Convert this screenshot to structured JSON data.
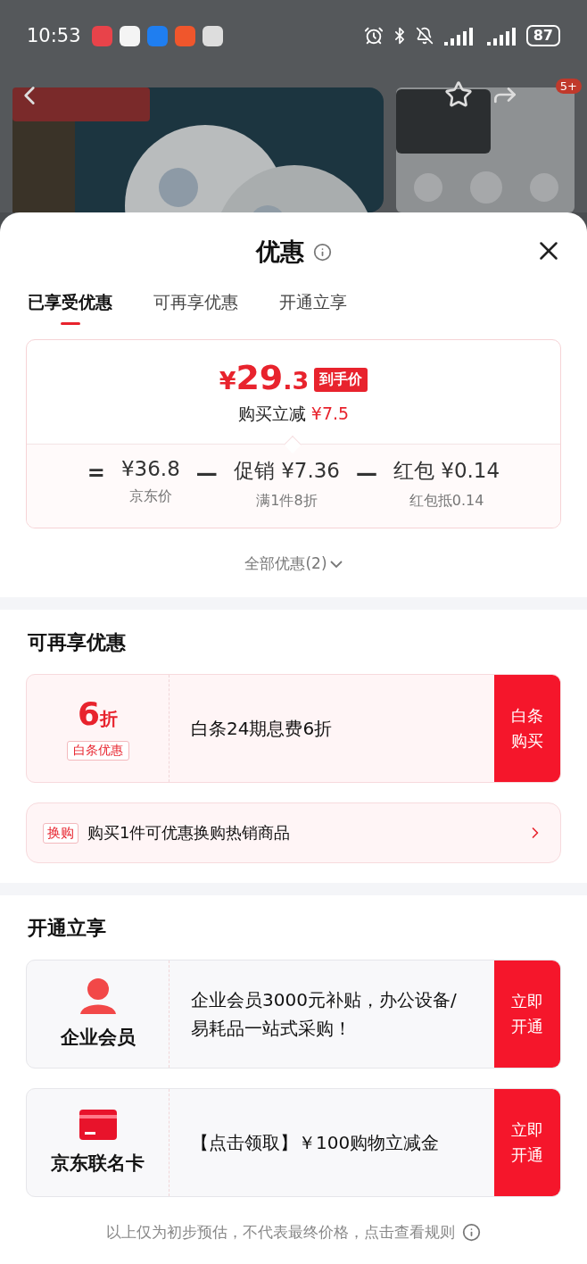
{
  "status_bar": {
    "time": "10:53",
    "battery": "87"
  },
  "background": {
    "kind": "picture",
    "badge": "5+"
  },
  "sheet": {
    "title": "优惠",
    "tabs": [
      {
        "label": "已享受优惠",
        "selected": true
      },
      {
        "label": "可再享优惠",
        "selected": false
      },
      {
        "label": "开通立享",
        "selected": false
      }
    ],
    "price_card": {
      "price": {
        "currency": "¥",
        "integer": "29",
        "decimal": ".3"
      },
      "price_tag": "到手价",
      "reduction_label": "购买立减",
      "reduction": "¥7.5",
      "breakdown": [
        {
          "kind": "operator",
          "text": "="
        },
        {
          "kind": "term",
          "amount": "¥36.8",
          "note": "京东价"
        },
        {
          "kind": "operator",
          "text": "—"
        },
        {
          "kind": "term",
          "prefix": "促销",
          "amount": "¥7.36",
          "note": "满1件8折"
        },
        {
          "kind": "operator",
          "text": "—"
        },
        {
          "kind": "term",
          "prefix": "红包",
          "amount": "¥0.14",
          "note": "红包抵0.14"
        }
      ]
    },
    "all_offers_link": "全部优惠(2)",
    "sections": [
      {
        "title": "可再享优惠",
        "offers": [
          {
            "kind": "discount",
            "value": "6",
            "unit": "折",
            "tag": "白条优惠",
            "text": "白条24期息费6折",
            "button": "白条购买"
          },
          {
            "kind": "exchange",
            "tag": "换购",
            "text": "购买1件可优惠换购热销商品"
          }
        ]
      },
      {
        "title": "开通立享",
        "offers": [
          {
            "kind": "member",
            "name": "企业会员",
            "text": "企业会员3000元补贴，办公设备/易耗品一站式采购！",
            "button": "立即开通"
          },
          {
            "kind": "card",
            "name": "京东联名卡",
            "text": "【点击领取】￥100购物立减金",
            "button": "立即开通"
          }
        ]
      }
    ],
    "footer": "以上仅为初步预估，不代表最终价格，点击查看规则"
  }
}
